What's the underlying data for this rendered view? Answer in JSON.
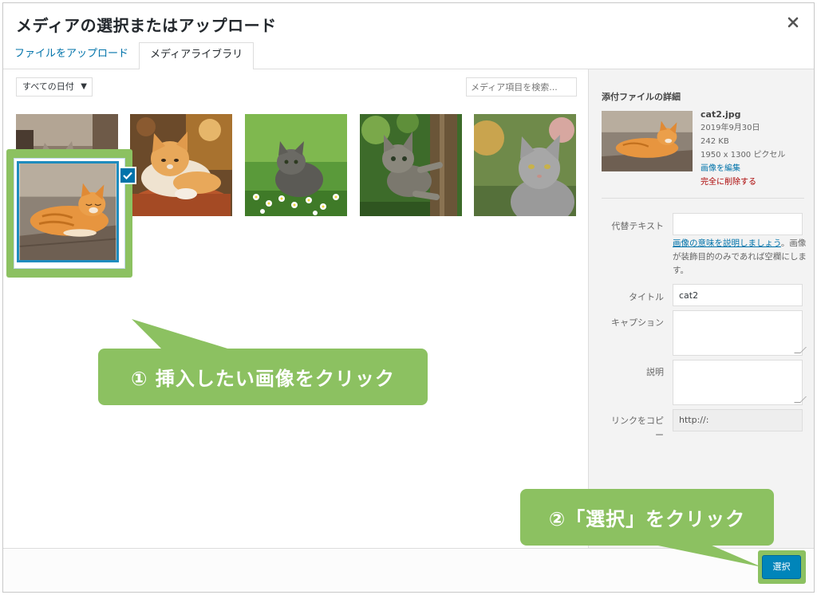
{
  "dialog": {
    "title": "メディアの選択またはアップロード",
    "close_icon": "close-icon"
  },
  "tabs": [
    {
      "label": "ファイルをアップロード",
      "active": false
    },
    {
      "label": "メディアライブラリ",
      "active": true
    }
  ],
  "toolbar": {
    "date_filter": "すべての日付",
    "search_placeholder": "メディア項目を検索..."
  },
  "media_items": [
    {
      "name": "cat-sleeping-tabby",
      "selected": false
    },
    {
      "name": "cat-orange-white-pot",
      "selected": false
    },
    {
      "name": "cat-kitten-grass-flowers",
      "selected": false
    },
    {
      "name": "cat-kitten-tree",
      "selected": false
    },
    {
      "name": "cat-gray-garden",
      "selected": false
    },
    {
      "name": "cat2",
      "selected": true
    }
  ],
  "details": {
    "heading": "添付ファイルの詳細",
    "filename": "cat2.jpg",
    "date": "2019年9月30日",
    "size": "242 KB",
    "dimensions": "1950 x 1300 ピクセル",
    "edit_link": "画像を編集",
    "delete_link": "完全に削除する",
    "alt_label": "代替テキスト",
    "alt_value": "",
    "alt_help_link": "画像の意味を説明しましょう",
    "alt_help_rest": "。画像が装飾目的のみであれば空欄にします。",
    "title_label": "タイトル",
    "title_value": "cat2",
    "caption_label": "キャプション",
    "description_label": "説明",
    "copy_link_label": "リンクをコピー",
    "copy_link_value": "http://:"
  },
  "footer": {
    "select_button": "選択"
  },
  "annotations": {
    "step1": "① 挿入したい画像をクリック",
    "step2": "②「選択」をクリック"
  },
  "colors": {
    "accent_green": "#8cc161",
    "wp_blue": "#0073aa",
    "button_blue": "#0085ba",
    "delete_red": "#a00000"
  }
}
